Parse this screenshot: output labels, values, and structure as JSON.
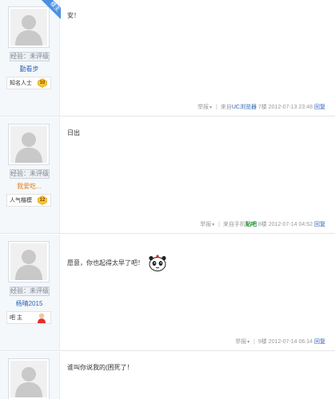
{
  "posts": [
    {
      "ribbon": "楼主",
      "score_label": "经验：未评级",
      "username": "勤看步",
      "badge_label": "知名人士",
      "level": "10",
      "content": "安！",
      "report": "举报",
      "via_prefix": "来自",
      "via_source": "UC浏览器",
      "floor": "7楼",
      "datetime": "2012-07-13 23:48",
      "reply": "回复"
    },
    {
      "score_label": "经验：未评级",
      "username": "我爱吃...",
      "badge_label": "人气楷模",
      "level": "12",
      "content": "日出",
      "report": "举报",
      "via_prefix": "来自手机",
      "via_source": "贴吧",
      "floor": "8楼",
      "datetime": "2012-07-14 04:52",
      "reply": "回复"
    },
    {
      "score_label": "经验：未评级",
      "username": "杨晴2015",
      "badge_label": "吧 主",
      "content": "愿意，你也起得太早了吧！",
      "report": "举报",
      "floor": "9楼",
      "datetime": "2012-07-14 06:14",
      "reply": "回复"
    },
    {
      "content": "谁叫你说我的(困死了！"
    }
  ],
  "colors": {
    "link_blue": "#2d64b3",
    "username_orange": "#e57d1d",
    "sidebar_bg": "#f4f8fb",
    "ribbon_blue": "#4a90e2",
    "source_green": "#1a8f2e"
  },
  "icons": {
    "avatar": "default-avatar-icon",
    "level": "level-badge-icon",
    "owner": "bar-owner-icon",
    "emoji": "panda-emoji-icon",
    "caret": "caret-down-icon"
  }
}
